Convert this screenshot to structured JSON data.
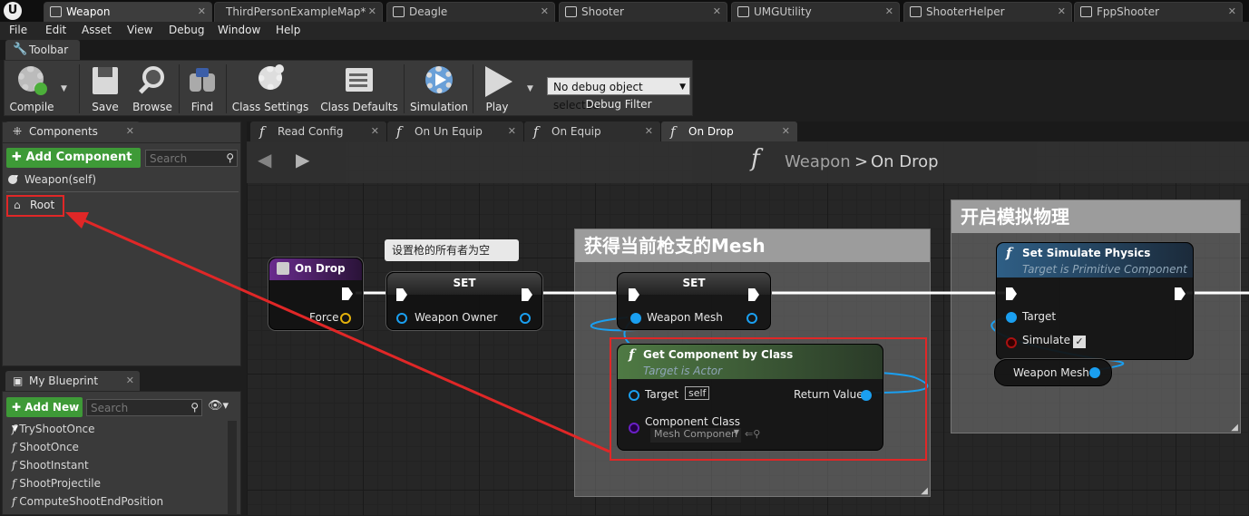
{
  "title_tabs": [
    {
      "label": "Weapon",
      "active": true
    },
    {
      "label": "ThirdPersonExampleMap*",
      "active": false
    },
    {
      "label": "Deagle",
      "active": false
    },
    {
      "label": "Shooter",
      "active": false
    },
    {
      "label": "UMGUtility",
      "active": false
    },
    {
      "label": "ShooterHelper",
      "active": false
    },
    {
      "label": "FppShooter",
      "active": false
    }
  ],
  "menu": [
    "File",
    "Edit",
    "Asset",
    "View",
    "Debug",
    "Window",
    "Help"
  ],
  "toolbar": {
    "panel_tab": "Toolbar",
    "compile": "Compile",
    "save": "Save",
    "browse": "Browse",
    "find": "Find",
    "class_settings": "Class Settings",
    "class_defaults": "Class Defaults",
    "simulation": "Simulation",
    "play": "Play",
    "debug_select": "No debug object selected",
    "debug_filter": "Debug Filter"
  },
  "components": {
    "tab": "Components",
    "add_component": "Add Component",
    "search_placeholder": "Search",
    "self_item": "Weapon(self)",
    "root_item": "Root"
  },
  "my_blueprint": {
    "tab": "My Blueprint",
    "add_new": "Add New",
    "search_placeholder": "Search",
    "functions": [
      "TryShootOnce",
      "ShootOnce",
      "ShootInstant",
      "ShootProjectile",
      "ComputeShootEndPosition"
    ]
  },
  "graph_tabs": [
    {
      "label": "Read Config",
      "active": false
    },
    {
      "label": "On Un Equip",
      "active": false
    },
    {
      "label": "On Equip",
      "active": false
    },
    {
      "label": "On Drop",
      "active": true
    }
  ],
  "breadcrumb": {
    "root": "Weapon",
    "sep": ">",
    "current": "On Drop"
  },
  "comments": {
    "mesh": "获得当前枪支的Mesh",
    "physics": "开启模拟物理",
    "bubble": "设置枪的所有者为空"
  },
  "nodes": {
    "on_drop": {
      "title": "On Drop",
      "pin_force": "Force"
    },
    "set_owner": {
      "title": "SET",
      "pin": "Weapon Owner"
    },
    "set_mesh": {
      "title": "SET",
      "pin": "Weapon Mesh"
    },
    "get_component": {
      "title": "Get Component by Class",
      "subtitle": "Target is Actor",
      "pin_target": "Target",
      "self_tag": "self",
      "pin_return": "Return Value",
      "pin_class": "Component Class",
      "class_value": "Mesh Componen"
    },
    "simulate": {
      "title": "Set Simulate Physics",
      "subtitle": "Target is Primitive Component",
      "pin_target": "Target",
      "pin_simulate": "Simulate"
    },
    "weapon_mesh_var": {
      "label": "Weapon Mesh"
    }
  },
  "colors": {
    "accent_green": "#3e9a37",
    "annotation_red": "#e02727",
    "pin_object": "#1a9ff0"
  }
}
